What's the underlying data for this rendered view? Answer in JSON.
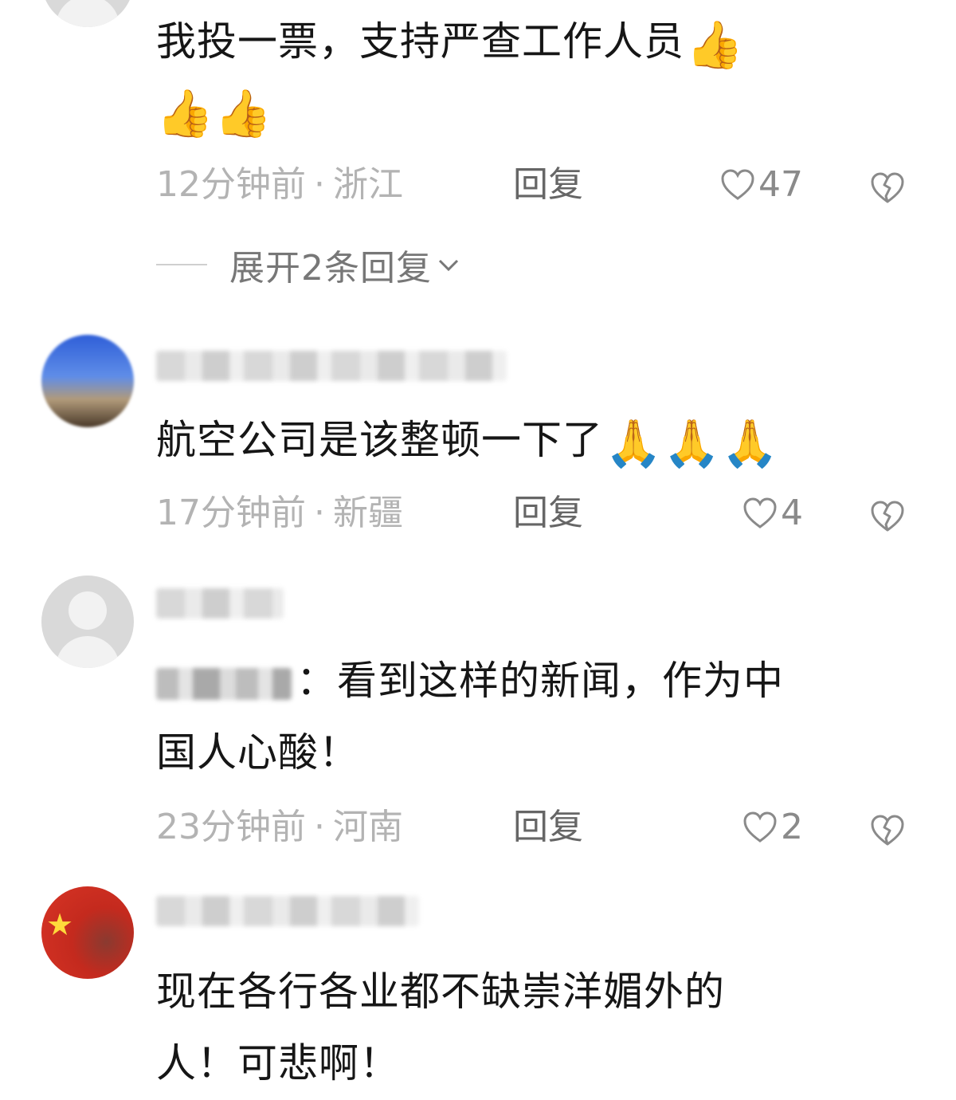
{
  "comments": [
    {
      "text": "我投一票，支持严查工作人员",
      "emoji_line1": "👍",
      "emoji_line2": "👍👍",
      "time": "12分钟前",
      "location": "浙江",
      "reply_label": "回复",
      "like_count": "47",
      "expand_label": "展开2条回复",
      "avatar": "default"
    },
    {
      "text": "航空公司是该整顿一下了",
      "emoji": "🙏🙏🙏",
      "time": "17分钟前",
      "location": "新疆",
      "reply_label": "回复",
      "like_count": "4",
      "avatar": "photo"
    },
    {
      "text_line1": "：看到这样的新闻，作为中",
      "text_line2": "国人心酸！",
      "time": "23分钟前",
      "location": "河南",
      "reply_label": "回复",
      "like_count": "2",
      "avatar": "default"
    },
    {
      "text_line1": "现在各行各业都不缺崇洋媚外的",
      "text_line2": "人！可悲啊！",
      "avatar": "flag",
      "avatar_symbol": "★"
    }
  ],
  "separator": "·",
  "icons": {
    "like": "heart-outline-icon",
    "dislike": "broken-heart-icon",
    "expand": "chevron-down-icon"
  },
  "colors": {
    "meta_text": "#b3b3b3",
    "reply_text": "#666666",
    "body_text": "#161616"
  }
}
